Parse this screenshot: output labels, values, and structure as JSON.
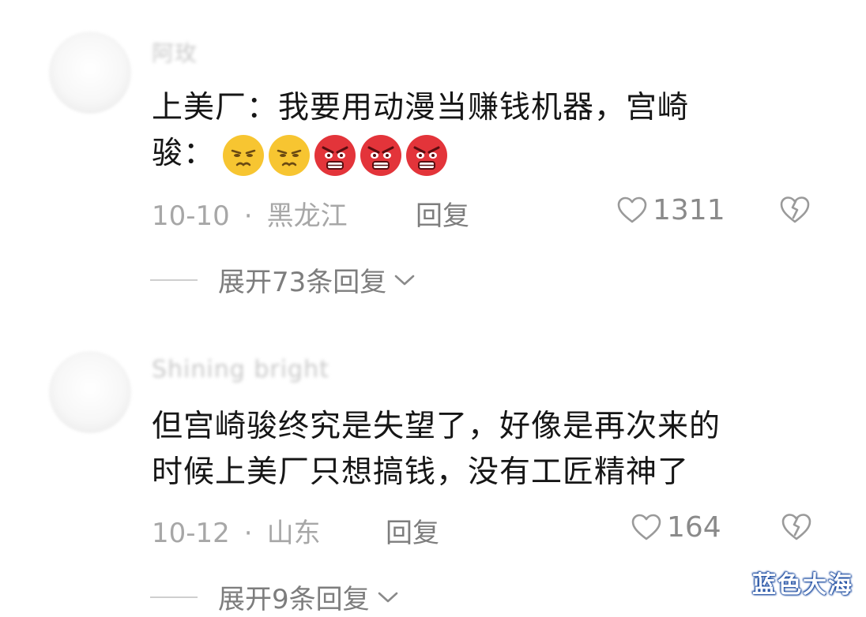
{
  "comments": [
    {
      "username": "阿玫",
      "text_lines": [
        "上美厂：我要用动漫当赚钱机器，宫崎",
        "骏："
      ],
      "emojis": [
        "smirk-emoji",
        "smirk-emoji",
        "angry-emoji",
        "angry-emoji",
        "angry-emoji"
      ],
      "date": "10-10",
      "separator": "·",
      "location": "黑龙江",
      "reply_label": "回复",
      "likes": "1311",
      "expand_label": "展开73条回复"
    },
    {
      "username": "Shining bright",
      "text_lines": [
        "但宫崎骏终究是失望了，好像是再次来的",
        "时候上美厂只想搞钱，没有工匠精神了"
      ],
      "date": "10-12",
      "separator": "·",
      "location": "山东",
      "reply_label": "回复",
      "likes": "164",
      "expand_label": "展开9条回复"
    }
  ],
  "watermark": "蓝色大海",
  "icons": {
    "like": "heart-outline-icon",
    "dislike": "broken-heart-icon",
    "expand": "chevron-down-icon"
  },
  "colors": {
    "text": "#161616",
    "meta": "#a7a7a7",
    "secondary": "#7d7d7d",
    "angry_red": "#e3343a",
    "smirk_yellow": "#f7c531"
  }
}
